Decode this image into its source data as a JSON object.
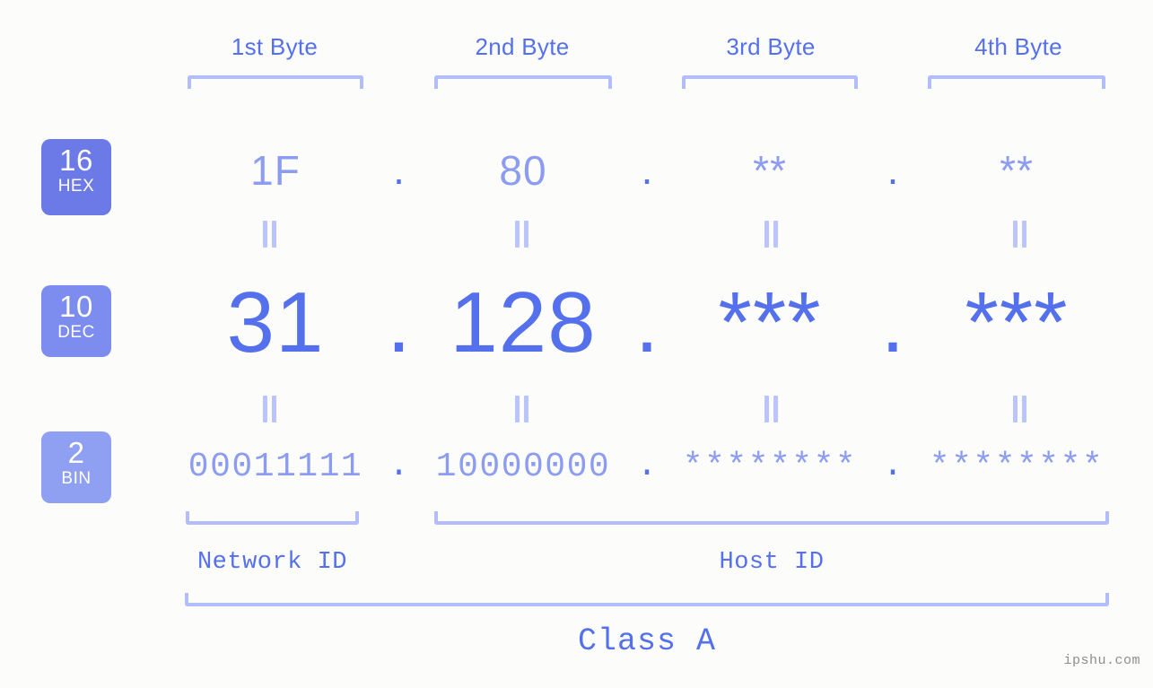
{
  "background_color": "#fcfdfa",
  "accent_dark": "#5570ec",
  "accent_mid": "#8c9cf0",
  "accent_light": "#b4bdfb",
  "headers": {
    "byte1": "1st Byte",
    "byte2": "2nd Byte",
    "byte3": "3rd Byte",
    "byte4": "4th Byte"
  },
  "bases": [
    {
      "number": "16",
      "label": "HEX",
      "color": "#6c7ae8"
    },
    {
      "number": "10",
      "label": "DEC",
      "color": "#7c8cef"
    },
    {
      "number": "2",
      "label": "BIN",
      "color": "#8fa0f3"
    }
  ],
  "separator": ".",
  "rows": {
    "hex": {
      "b1": "1F",
      "b2": "80",
      "b3": "**",
      "b4": "**"
    },
    "dec": {
      "b1": "31",
      "b2": "128",
      "b3": "***",
      "b4": "***"
    },
    "bin": {
      "b1": "00011111",
      "b2": "10000000",
      "b3": "********",
      "b4": "********"
    }
  },
  "equals_symbol": "=",
  "sections": {
    "network_id": "Network ID",
    "host_id": "Host ID",
    "class": "Class A"
  },
  "watermark": "ipshu.com"
}
